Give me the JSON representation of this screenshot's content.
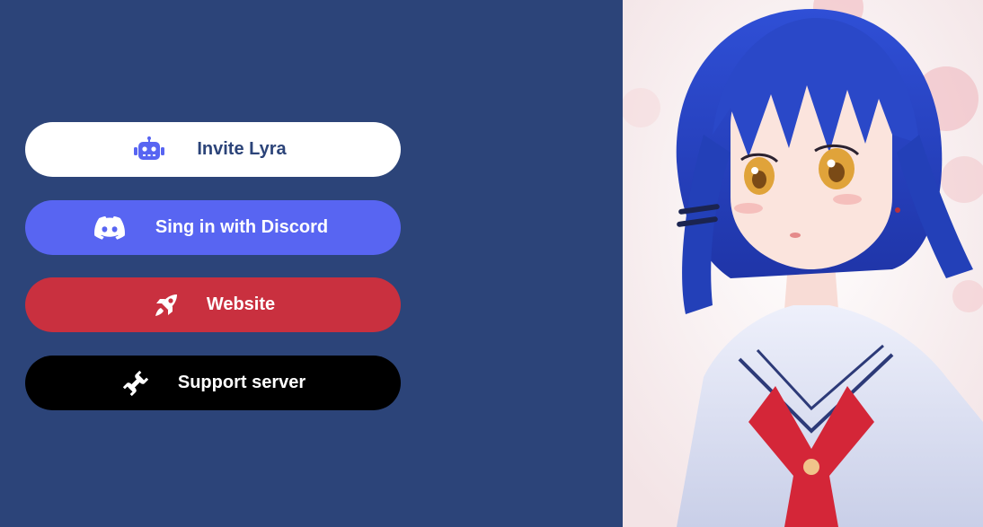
{
  "buttons": {
    "invite": {
      "label": "Invite Lyra",
      "icon": "robot-icon",
      "bg": "#ffffff",
      "fg": "#2c4479"
    },
    "discord": {
      "label": "Sing in with Discord",
      "icon": "discord-icon",
      "bg": "#5865f2",
      "fg": "#ffffff"
    },
    "website": {
      "label": "Website",
      "icon": "rocket-icon",
      "bg": "#c9303f",
      "fg": "#ffffff"
    },
    "support": {
      "label": "Support server",
      "icon": "wrench-icon",
      "bg": "#000000",
      "fg": "#ffffff"
    }
  },
  "colors": {
    "background": "#2c4479",
    "art_hair": "#2a48c8",
    "art_eyes": "#e0a33a",
    "art_scarf": "#d42638"
  }
}
